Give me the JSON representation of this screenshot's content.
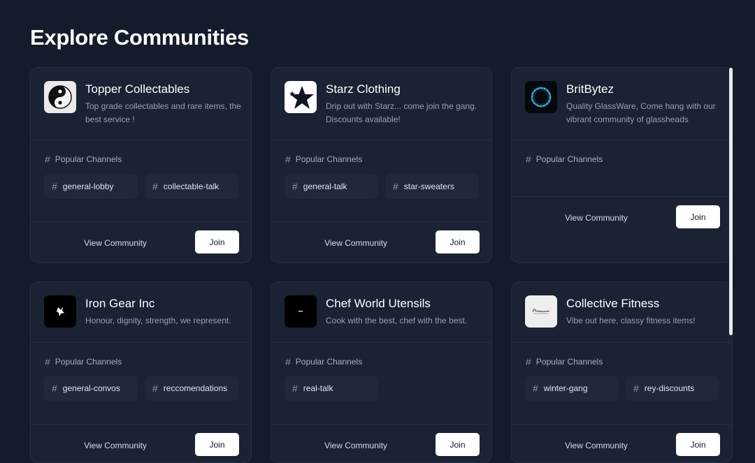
{
  "page": {
    "title": "Explore Communities"
  },
  "labels": {
    "popular_channels": "Popular Channels",
    "view_community": "View Community",
    "join": "Join",
    "hash": "#"
  },
  "communities": [
    {
      "name": "Topper Collectables",
      "description": "Top grade collectables and rare items, the best service !",
      "logo_icon": "yin-yang-icon",
      "channels": [
        "general-lobby",
        "collectable-talk"
      ]
    },
    {
      "name": "Starz Clothing",
      "description": "Drip out with Starz... come join the gang. Discounts available!",
      "logo_icon": "star-icon",
      "channels": [
        "general-talk",
        "star-sweaters"
      ]
    },
    {
      "name": "BritBytez",
      "description": "Quality GlassWare, Come hang with our vibrant community of glassheads",
      "logo_icon": "glass-ring-icon",
      "channels": []
    },
    {
      "name": "Iron Gear Inc",
      "description": "Honour, dignity, strength, we represent.",
      "logo_icon": "iron-gear-logo-icon",
      "channels": [
        "general-convos",
        "reccomendations"
      ]
    },
    {
      "name": "Chef World Utensils",
      "description": "Cook with the best, chef with the best.",
      "logo_icon": "chef-world-logo-icon",
      "channels": [
        "real-talk"
      ]
    },
    {
      "name": "Collective Fitness",
      "description": "Vibe out here, classy fitness items!",
      "logo_icon": "collective-signature-icon",
      "channels": [
        "winter-gang",
        "rey-discounts"
      ]
    }
  ],
  "colors": {
    "background": "#141b2b",
    "card": "#1a2233",
    "chip": "#202839",
    "join_button": "#ffffff"
  }
}
